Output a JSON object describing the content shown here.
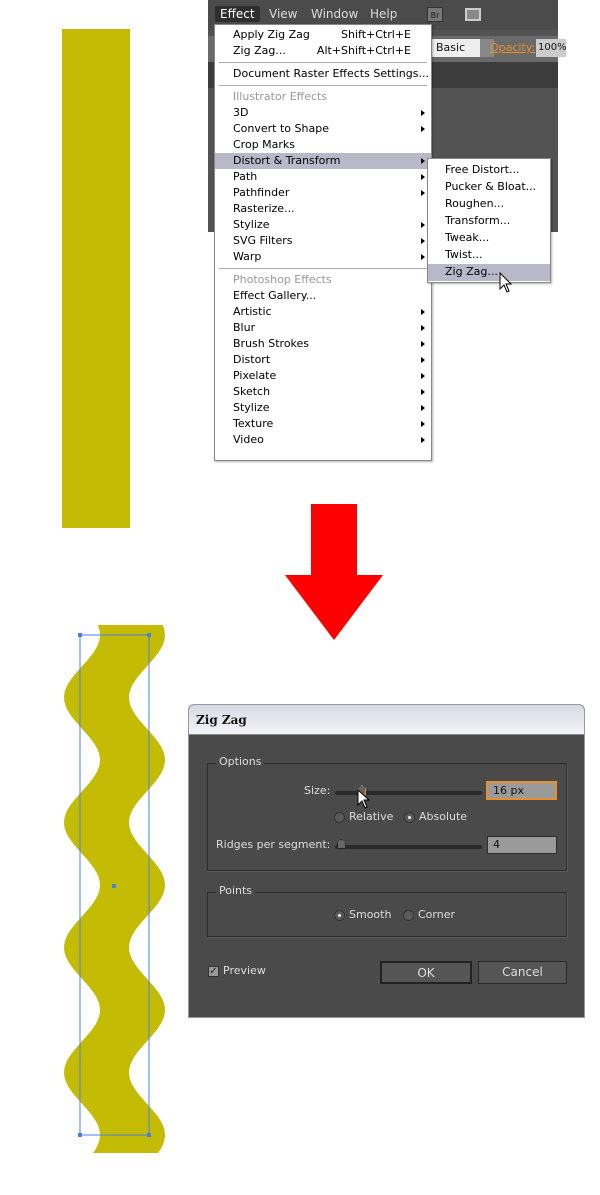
{
  "menubar": {
    "items": [
      "Effect",
      "View",
      "Window",
      "Help"
    ],
    "active": "Effect",
    "bridge_label": "Br"
  },
  "control_bar": {
    "style_value": "Basic",
    "opacity_label": "Opacity:",
    "opacity_value": "100%"
  },
  "effect_menu": {
    "top_items": [
      {
        "label": "Apply Zig Zag",
        "shortcut": "Shift+Ctrl+E"
      },
      {
        "label": "Zig Zag...",
        "shortcut": "Alt+Shift+Ctrl+E"
      }
    ],
    "raster_settings": "Document Raster Effects Settings...",
    "illustrator_header": "Illustrator Effects",
    "illustrator_items": [
      {
        "label": "3D",
        "sub": true
      },
      {
        "label": "Convert to Shape",
        "sub": true
      },
      {
        "label": "Crop Marks",
        "sub": false
      },
      {
        "label": "Distort & Transform",
        "sub": true,
        "highlighted": true
      },
      {
        "label": "Path",
        "sub": true
      },
      {
        "label": "Pathfinder",
        "sub": true
      },
      {
        "label": "Rasterize...",
        "sub": false
      },
      {
        "label": "Stylize",
        "sub": true
      },
      {
        "label": "SVG Filters",
        "sub": true
      },
      {
        "label": "Warp",
        "sub": true
      }
    ],
    "photoshop_header": "Photoshop Effects",
    "photoshop_items": [
      {
        "label": "Effect Gallery...",
        "sub": false
      },
      {
        "label": "Artistic",
        "sub": true
      },
      {
        "label": "Blur",
        "sub": true
      },
      {
        "label": "Brush Strokes",
        "sub": true
      },
      {
        "label": "Distort",
        "sub": true
      },
      {
        "label": "Pixelate",
        "sub": true
      },
      {
        "label": "Sketch",
        "sub": true
      },
      {
        "label": "Stylize",
        "sub": true
      },
      {
        "label": "Texture",
        "sub": true
      },
      {
        "label": "Video",
        "sub": true
      }
    ]
  },
  "submenu": {
    "items": [
      "Free Distort...",
      "Pucker & Bloat...",
      "Roughen...",
      "Transform...",
      "Tweak...",
      "Twist...",
      "Zig Zag..."
    ],
    "highlighted": "Zig Zag..."
  },
  "dialog": {
    "title": "Zig Zag",
    "options_label": "Options",
    "size_label": "Size:",
    "size_value": "16 px",
    "size_slider_fraction": 0.18,
    "relative_label": "Relative",
    "absolute_label": "Absolute",
    "mode": "Absolute",
    "ridges_label": "Ridges per segment:",
    "ridges_value": "4",
    "ridges_slider_fraction": 0.04,
    "points_label": "Points",
    "smooth_label": "Smooth",
    "corner_label": "Corner",
    "points_mode": "Smooth",
    "preview_label": "Preview",
    "preview_checked": true,
    "ok_label": "OK",
    "cancel_label": "Cancel"
  },
  "colors": {
    "shape": "#c4bc04",
    "arrow": "#ff0000",
    "selection": "#4a7fe0",
    "focus": "#e8902a"
  }
}
